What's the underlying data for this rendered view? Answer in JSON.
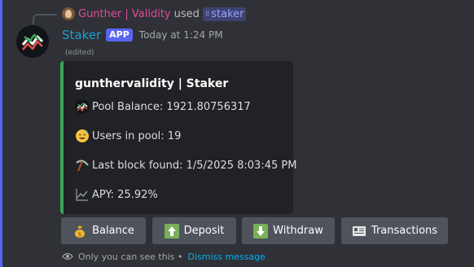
{
  "reply": {
    "username": "Gunther | Validity",
    "used_text": "used",
    "command_name": "staker"
  },
  "message": {
    "bot_name": "Staker",
    "badge": "APP",
    "timestamp": "Today at 1:24 PM",
    "edited": "(edited)"
  },
  "embed": {
    "accent_color": "#3ba55d",
    "title": "gunthervalidity | Staker",
    "fields": [
      {
        "icon": "staker-logo-icon",
        "text": "Pool Balance: 1921.80756317"
      },
      {
        "icon": "sweat-smile-emoji-icon",
        "text": "Users in pool: 19"
      },
      {
        "icon": "pickaxe-icon",
        "text": "Last block found: 1/5/2025 8:03:45 PM"
      },
      {
        "icon": "chart-line-icon",
        "text": "APY: 25.92%"
      }
    ]
  },
  "buttons": [
    {
      "icon": "money-bag-icon",
      "label": "Balance"
    },
    {
      "icon": "arrow-up-icon",
      "label": "Deposit"
    },
    {
      "icon": "arrow-down-icon",
      "label": "Withdraw"
    },
    {
      "icon": "receipt-icon",
      "label": "Transactions"
    }
  ],
  "ephemeral": {
    "notice": "Only you can see this •",
    "dismiss_label": "Dismiss message"
  },
  "colors": {
    "background": "#2f3136",
    "bot_name": "#1b9fd4",
    "reply_user": "#e04a9a",
    "app_badge": "#5865f2",
    "link": "#00aff4"
  }
}
